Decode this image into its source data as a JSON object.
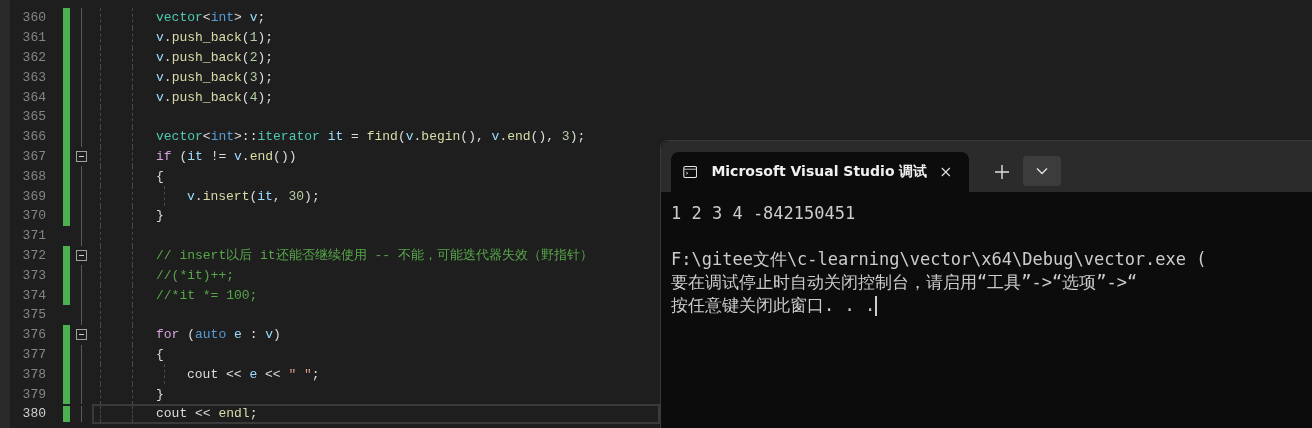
{
  "editor": {
    "lines": [
      {
        "number": "360",
        "changed": true,
        "fold": false,
        "current": false,
        "tokens": [
          {
            "kind": "type",
            "text": "vector"
          },
          {
            "kind": "plain",
            "text": "<"
          },
          {
            "kind": "kw",
            "text": "int"
          },
          {
            "kind": "plain",
            "text": "> "
          },
          {
            "kind": "var",
            "text": "v"
          },
          {
            "kind": "plain",
            "text": ";"
          }
        ]
      },
      {
        "number": "361",
        "changed": true,
        "fold": false,
        "current": false,
        "tokens": [
          {
            "kind": "var",
            "text": "v"
          },
          {
            "kind": "plain",
            "text": "."
          },
          {
            "kind": "fn",
            "text": "push_back"
          },
          {
            "kind": "plain",
            "text": "("
          },
          {
            "kind": "num",
            "text": "1"
          },
          {
            "kind": "plain",
            "text": ");"
          }
        ]
      },
      {
        "number": "362",
        "changed": true,
        "fold": false,
        "current": false,
        "tokens": [
          {
            "kind": "var",
            "text": "v"
          },
          {
            "kind": "plain",
            "text": "."
          },
          {
            "kind": "fn",
            "text": "push_back"
          },
          {
            "kind": "plain",
            "text": "("
          },
          {
            "kind": "num",
            "text": "2"
          },
          {
            "kind": "plain",
            "text": ");"
          }
        ]
      },
      {
        "number": "363",
        "changed": true,
        "fold": false,
        "current": false,
        "tokens": [
          {
            "kind": "var",
            "text": "v"
          },
          {
            "kind": "plain",
            "text": "."
          },
          {
            "kind": "fn",
            "text": "push_back"
          },
          {
            "kind": "plain",
            "text": "("
          },
          {
            "kind": "num",
            "text": "3"
          },
          {
            "kind": "plain",
            "text": ");"
          }
        ]
      },
      {
        "number": "364",
        "changed": true,
        "fold": false,
        "current": false,
        "tokens": [
          {
            "kind": "var",
            "text": "v"
          },
          {
            "kind": "plain",
            "text": "."
          },
          {
            "kind": "fn",
            "text": "push_back"
          },
          {
            "kind": "plain",
            "text": "("
          },
          {
            "kind": "num",
            "text": "4"
          },
          {
            "kind": "plain",
            "text": ");"
          }
        ]
      },
      {
        "number": "365",
        "changed": true,
        "fold": false,
        "current": false
      },
      {
        "number": "366",
        "changed": true,
        "fold": false,
        "current": false,
        "tokens": [
          {
            "kind": "type",
            "text": "vector"
          },
          {
            "kind": "plain",
            "text": "<"
          },
          {
            "kind": "kw",
            "text": "int"
          },
          {
            "kind": "plain",
            "text": ">::"
          },
          {
            "kind": "type",
            "text": "iterator"
          },
          {
            "kind": "var",
            "text": " it"
          },
          {
            "kind": "plain",
            "text": " = "
          },
          {
            "kind": "fn",
            "text": "find"
          },
          {
            "kind": "plain",
            "text": "("
          },
          {
            "kind": "var",
            "text": "v"
          },
          {
            "kind": "plain",
            "text": "."
          },
          {
            "kind": "fn",
            "text": "begin"
          },
          {
            "kind": "plain",
            "text": "(), "
          },
          {
            "kind": "var",
            "text": "v"
          },
          {
            "kind": "plain",
            "text": "."
          },
          {
            "kind": "fn",
            "text": "end"
          },
          {
            "kind": "plain",
            "text": "(), "
          },
          {
            "kind": "num",
            "text": "3"
          },
          {
            "kind": "plain",
            "text": ");"
          }
        ]
      },
      {
        "number": "367",
        "changed": true,
        "fold": true,
        "current": false,
        "tokens": [
          {
            "kind": "ctrl",
            "text": "if"
          },
          {
            "kind": "plain",
            "text": " ("
          },
          {
            "kind": "var",
            "text": "it"
          },
          {
            "kind": "plain",
            "text": " != "
          },
          {
            "kind": "var",
            "text": "v"
          },
          {
            "kind": "plain",
            "text": "."
          },
          {
            "kind": "fn",
            "text": "end"
          },
          {
            "kind": "plain",
            "text": "())"
          }
        ]
      },
      {
        "number": "368",
        "changed": true,
        "fold": false,
        "current": false,
        "tokens": [
          {
            "kind": "plain",
            "text": "{"
          }
        ],
        "children": [
          {
            "number": "369",
            "changed": true,
            "fold": false,
            "current": false,
            "tokens": [
              {
                "kind": "var",
                "text": "v"
              },
              {
                "kind": "plain",
                "text": "."
              },
              {
                "kind": "fn",
                "text": "insert"
              },
              {
                "kind": "plain",
                "text": "("
              },
              {
                "kind": "var",
                "text": "it"
              },
              {
                "kind": "plain",
                "text": ", "
              },
              {
                "kind": "num",
                "text": "30"
              },
              {
                "kind": "plain",
                "text": ");"
              }
            ]
          }
        ]
      },
      {
        "number": "370",
        "changed": true,
        "fold": false,
        "current": false,
        "tokens": [
          {
            "kind": "plain",
            "text": "}"
          }
        ]
      },
      {
        "number": "371",
        "changed": false,
        "fold": false,
        "current": false
      },
      {
        "number": "372",
        "changed": true,
        "fold": true,
        "current": false,
        "tokens": [
          {
            "kind": "comment",
            "text": "// insert以后 it还能否继续使用 -- 不能，可能迭代器失效（野指针）"
          }
        ]
      },
      {
        "number": "373",
        "changed": true,
        "fold": false,
        "current": false,
        "tokens": [
          {
            "kind": "comment",
            "text": "//(*it)++;"
          }
        ]
      },
      {
        "number": "374",
        "changed": true,
        "fold": false,
        "current": false,
        "tokens": [
          {
            "kind": "comment",
            "text": "//*it *= 100;"
          }
        ]
      },
      {
        "number": "375",
        "changed": false,
        "fold": false,
        "current": false
      },
      {
        "number": "376",
        "changed": true,
        "fold": true,
        "current": false,
        "tokens": [
          {
            "kind": "ctrl",
            "text": "for"
          },
          {
            "kind": "plain",
            "text": " ("
          },
          {
            "kind": "kw",
            "text": "auto"
          },
          {
            "kind": "var",
            "text": " e"
          },
          {
            "kind": "plain",
            "text": " : "
          },
          {
            "kind": "var",
            "text": "v"
          },
          {
            "kind": "plain",
            "text": ")"
          }
        ]
      },
      {
        "number": "377",
        "changed": true,
        "fold": false,
        "current": false,
        "tokens": [
          {
            "kind": "plain",
            "text": "{"
          }
        ],
        "children": [
          {
            "number": "378",
            "changed": true,
            "fold": false,
            "current": false,
            "tokens": [
              {
                "kind": "plain",
                "text": "cout << "
              },
              {
                "kind": "var",
                "text": "e"
              },
              {
                "kind": "plain",
                "text": " << "
              },
              {
                "kind": "str",
                "text": "\" \""
              },
              {
                "kind": "plain",
                "text": ";"
              }
            ]
          }
        ]
      },
      {
        "number": "379",
        "changed": true,
        "fold": false,
        "current": false,
        "tokens": [
          {
            "kind": "plain",
            "text": "}"
          }
        ]
      },
      {
        "number": "380",
        "changed": true,
        "fold": false,
        "current": true,
        "tokens": [
          {
            "kind": "plain",
            "text": "cout << "
          },
          {
            "kind": "fn",
            "text": "endl"
          },
          {
            "kind": "plain",
            "text": ";"
          }
        ]
      }
    ]
  },
  "terminal": {
    "tab_title": "Microsoft Visual Studio 调试",
    "cursor": true,
    "blocks": [
      [
        "1 2 3 4 -842150451"
      ],
      [
        "F:\\gitee文件\\c-learning\\vector\\x64\\Debug\\vector.exe (",
        "要在调试停止时自动关闭控制台，请启用“工具”->“选项”->“",
        "按任意键关闭此窗口. . ."
      ]
    ]
  }
}
